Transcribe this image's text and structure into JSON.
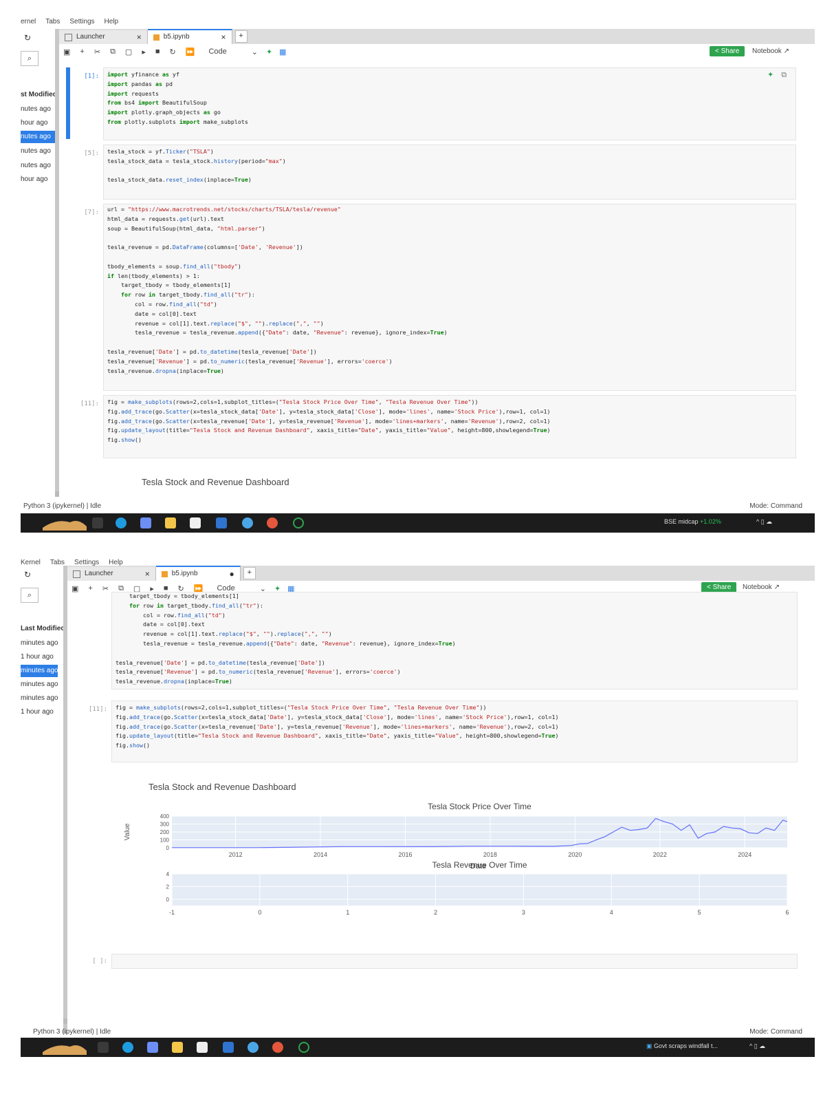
{
  "menu": {
    "top": [
      "ernel",
      "Tabs",
      "Settings",
      "Help"
    ],
    "bottom": [
      "Kernel",
      "Tabs",
      "Settings",
      "Help"
    ]
  },
  "file_browser": {
    "top": {
      "header": "st Modifiec",
      "rows": [
        "nutes ago",
        "hour ago",
        "nutes ago",
        "nutes ago",
        "nutes ago",
        "hour ago"
      ],
      "selected_index": 2
    },
    "bottom": {
      "header": "Last Modifiec",
      "rows": [
        "minutes ago",
        "1 hour ago",
        "minutes ago",
        "minutes ago",
        "minutes ago",
        "1 hour ago"
      ],
      "selected_index": 2
    },
    "refresh_icon": "refresh-icon",
    "search_icon": "search-icon"
  },
  "tabs": {
    "launcher": "Launcher",
    "notebook": "b5.ipynb",
    "close": "×",
    "modified_dot": "●",
    "plus": "+"
  },
  "toolbar": {
    "icons": [
      "save-icon",
      "add-cell-icon",
      "cut-icon",
      "copy-icon",
      "paste-icon",
      "run-icon",
      "stop-icon",
      "restart-icon",
      "fast-forward-icon"
    ],
    "cell_type": "Code",
    "share": "Share",
    "notebook_label": "Notebook"
  },
  "cells": {
    "c1_prompt": "[1]:",
    "c2_prompt": "[5]:",
    "c3_prompt": "[7]:",
    "c4_prompt": "[11]:",
    "c5_prompt": "[ ]:"
  },
  "dashboard": {
    "title": "Tesla Stock and Revenue Dashboard"
  },
  "chart_data": [
    {
      "type": "line",
      "title": "Tesla Stock Price Over Time",
      "xlabel": "Date",
      "ylabel": "Value",
      "x_ticks": [
        "2012",
        "2014",
        "2016",
        "2018",
        "2020",
        "2022",
        "2024"
      ],
      "y_ticks": [
        "0",
        "100",
        "200",
        "300",
        "400"
      ],
      "ylim": [
        0,
        400
      ],
      "xlim": [
        2010.5,
        2025.0
      ],
      "grid": true,
      "series": [
        {
          "name": "Stock Price",
          "color": "#636efa",
          "x": [
            2010.5,
            2011.5,
            2012.5,
            2013.5,
            2014.5,
            2015.5,
            2016.5,
            2017.5,
            2018.5,
            2019.5,
            2019.9,
            2020.1,
            2020.3,
            2020.5,
            2020.7,
            2020.9,
            2021.1,
            2021.3,
            2021.5,
            2021.7,
            2021.9,
            2022.1,
            2022.3,
            2022.5,
            2022.7,
            2022.9,
            2023.1,
            2023.3,
            2023.5,
            2023.7,
            2023.9,
            2024.1,
            2024.3,
            2024.5,
            2024.7,
            2024.9,
            2025.0
          ],
          "y": [
            2,
            2,
            2,
            8,
            15,
            15,
            14,
            20,
            20,
            18,
            28,
            50,
            55,
            100,
            140,
            200,
            260,
            220,
            230,
            250,
            370,
            330,
            300,
            220,
            290,
            120,
            180,
            200,
            270,
            250,
            240,
            190,
            180,
            250,
            220,
            350,
            330
          ]
        }
      ]
    },
    {
      "type": "line",
      "title": "Tesla Revenue Over Time",
      "x_ticks": [
        "-1",
        "0",
        "1",
        "2",
        "3",
        "4",
        "5",
        "6"
      ],
      "y_ticks": [
        "0",
        "2",
        "4"
      ],
      "xlim": [
        -1,
        6
      ],
      "ylim": [
        -1,
        4
      ],
      "grid": true,
      "series": []
    }
  ],
  "status": {
    "kernel": "Python 3 (ipykernel) | Idle",
    "mode": "Mode: Command"
  },
  "taskbar": {
    "top_right": "BSE midcap",
    "top_right_change": "+1.02%",
    "bottom_right": "Govt scraps windfall t..."
  }
}
